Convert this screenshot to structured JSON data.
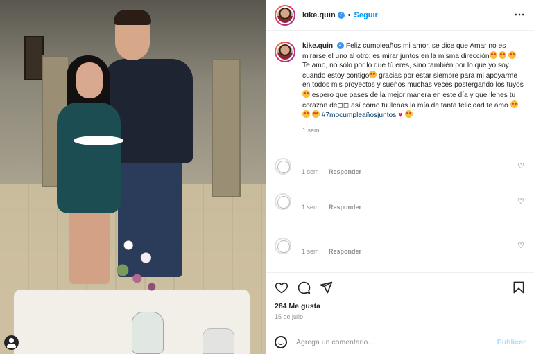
{
  "post": {
    "username": "kike.quin",
    "follow_label": "Seguir",
    "separator": "•",
    "more_icon": "⋯"
  },
  "caption": {
    "username": "kike.quin",
    "line1": "Feliz cumpleaños mi amor, se dice que Amar no es mirarse el uno al otro; es mirar juntos en la misma dirección",
    "line2": "Te amo, no solo por lo que tú eres, sino también por lo que yo soy cuando estoy contigo",
    "line3": " gracias por estar siempre para mi apoyarme en todos mis proyectos y sueños muchas veces postergando los tuyos",
    "line4": " espero que pases de la mejor manera en este día y que llenes tu corazón de◻◻ así como tú llenas la mía de tanta felicidad te amo",
    "hashtag": "#7mocumpleañosjuntos",
    "time": "1 sem"
  },
  "comments": [
    {
      "time": "1 sem",
      "reply": "Responder"
    },
    {
      "time": "1 sem",
      "reply": "Responder"
    },
    {
      "time": "1 sem",
      "reply": "Responder"
    }
  ],
  "actions": {
    "likes": "284 Me gusta",
    "date": "15 de julio"
  },
  "add_comment": {
    "placeholder": "Agrega un comentario...",
    "post_label": "Publicar"
  },
  "colors": {
    "link_blue": "#0095f6",
    "hashtag": "#00376b",
    "muted": "#8e8e8e"
  }
}
